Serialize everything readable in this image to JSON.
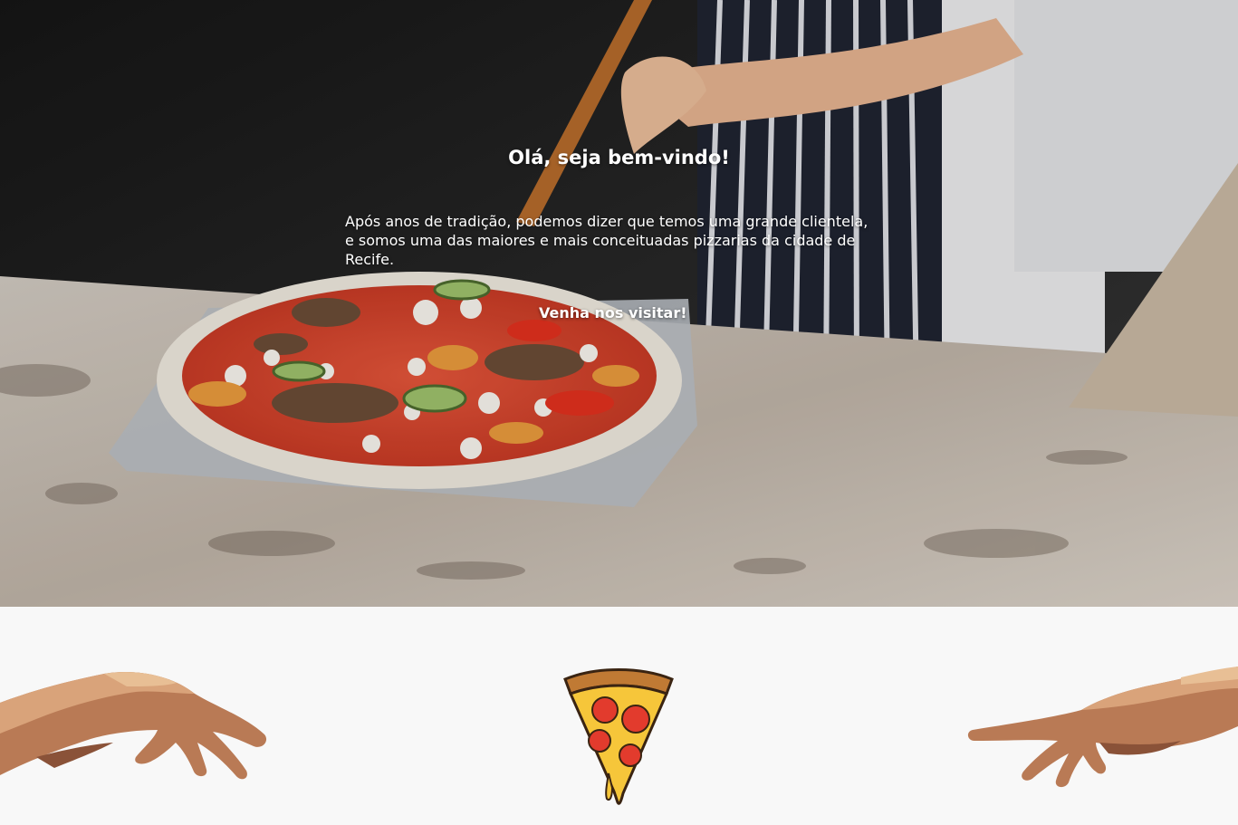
{
  "hero": {
    "title": "Olá, seja bem-vindo!",
    "description": "Após anos de tradição, podemos dizer que temos uma grande clientela, e somos uma das maiores e mais conceituadas pizzarias da cidade de Recife.",
    "cta": "Venha nos visitar!"
  },
  "colors": {
    "hero_text": "#ffffff",
    "bottom_background": "#f8f8f8",
    "pizza_sauce": "#d9412e",
    "pepperoni": "#e23b2d",
    "cheese": "#f6c63a"
  },
  "icons": {
    "left_hand": "reaching-hand-left-icon",
    "right_hand": "reaching-hand-right-icon",
    "pizza": "pizza-slice-icon"
  }
}
